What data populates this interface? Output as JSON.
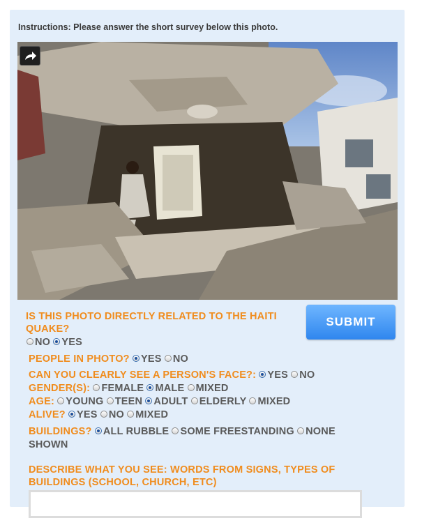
{
  "instructions": "Instructions: Please answer the short survey below this photo.",
  "photo": {
    "share_icon": "share-arrow-icon"
  },
  "submit_label": "SUBMIT",
  "q_related": {
    "line1": "IS THIS PHOTO DIRECTLY RELATED TO THE HAITI",
    "line2": "QUAKE?",
    "options": [
      "NO",
      "YES"
    ],
    "selected": "YES"
  },
  "q_people": {
    "label": "PEOPLE IN PHOTO?",
    "options": [
      "YES",
      "NO"
    ],
    "selected": "YES"
  },
  "q_face": {
    "label": "CAN YOU CLEARLY SEE A PERSON'S FACE?:",
    "options": [
      "YES",
      "NO"
    ],
    "selected": "YES"
  },
  "q_gender": {
    "label": "GENDER(S):",
    "options": [
      "FEMALE",
      "MALE",
      "MIXED"
    ],
    "selected": "MALE"
  },
  "q_age": {
    "label": "AGE:",
    "options": [
      "YOUNG",
      "TEEN",
      "ADULT",
      "ELDERLY",
      "MIXED"
    ],
    "selected": "ADULT"
  },
  "q_alive": {
    "label": "ALIVE?",
    "options": [
      "YES",
      "NO",
      "MIXED"
    ],
    "selected": "YES"
  },
  "q_buildings": {
    "label": "BUILDINGS?",
    "options": [
      "ALL RUBBLE",
      "SOME FREESTANDING",
      "NONE"
    ],
    "continuation": "SHOWN",
    "selected": "ALL RUBBLE"
  },
  "q_describe": {
    "line1": "DESCRIBE WHAT YOU SEE: WORDS FROM SIGNS, TYPES OF",
    "line2": "BUILDINGS (SCHOOL, CHURCH, ETC)",
    "value": ""
  }
}
